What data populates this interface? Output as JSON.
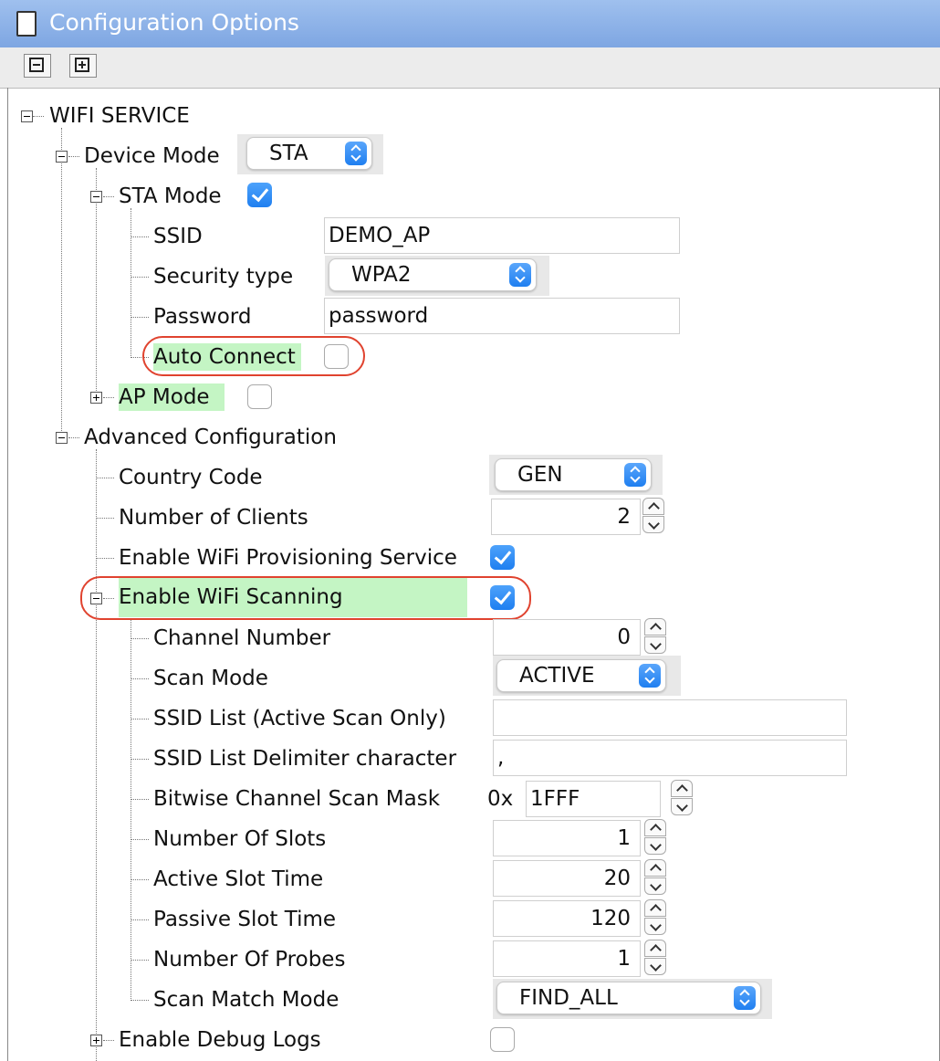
{
  "window": {
    "title": "Configuration Options"
  },
  "toolbar": {
    "collapse_all": "collapse-all",
    "expand_all": "expand-all"
  },
  "tree": {
    "wifi_service": "WIFI SERVICE",
    "device_mode": {
      "label": "Device Mode",
      "value": "STA"
    },
    "sta_mode": {
      "label": "STA Mode",
      "checked": true
    },
    "ssid": {
      "label": "SSID",
      "value": "DEMO_AP"
    },
    "security_type": {
      "label": "Security type",
      "value": "WPA2"
    },
    "password": {
      "label": "Password",
      "value": "password"
    },
    "auto_connect": {
      "label": "Auto Connect",
      "checked": false
    },
    "ap_mode": {
      "label": "AP Mode",
      "checked": false
    },
    "advanced": "Advanced Configuration",
    "country_code": {
      "label": "Country Code",
      "value": "GEN"
    },
    "num_clients": {
      "label": "Number of Clients",
      "value": "2"
    },
    "provisioning": {
      "label": "Enable WiFi Provisioning Service",
      "checked": true
    },
    "scanning": {
      "label": "Enable WiFi Scanning",
      "checked": true
    },
    "channel_number": {
      "label": "Channel Number",
      "value": "0"
    },
    "scan_mode": {
      "label": "Scan Mode",
      "value": "ACTIVE"
    },
    "ssid_list": {
      "label": "SSID List (Active Scan Only)",
      "value": ""
    },
    "ssid_delim": {
      "label": "SSID List Delimiter character",
      "value": ","
    },
    "channel_mask": {
      "label": "Bitwise Channel Scan Mask",
      "prefix": "0x",
      "value": "1FFF"
    },
    "num_slots": {
      "label": "Number Of Slots",
      "value": "1"
    },
    "active_slot": {
      "label": "Active Slot Time",
      "value": "20"
    },
    "passive_slot": {
      "label": "Passive Slot Time",
      "value": "120"
    },
    "num_probes": {
      "label": "Number Of Probes",
      "value": "1"
    },
    "scan_match": {
      "label": "Scan Match Mode",
      "value": "FIND_ALL"
    },
    "debug_logs": {
      "label": "Enable Debug Logs",
      "checked": false
    }
  },
  "colors": {
    "highlight": "#c4f5c4",
    "annotation": "#e0432f",
    "accent": "#1f7ff0"
  }
}
